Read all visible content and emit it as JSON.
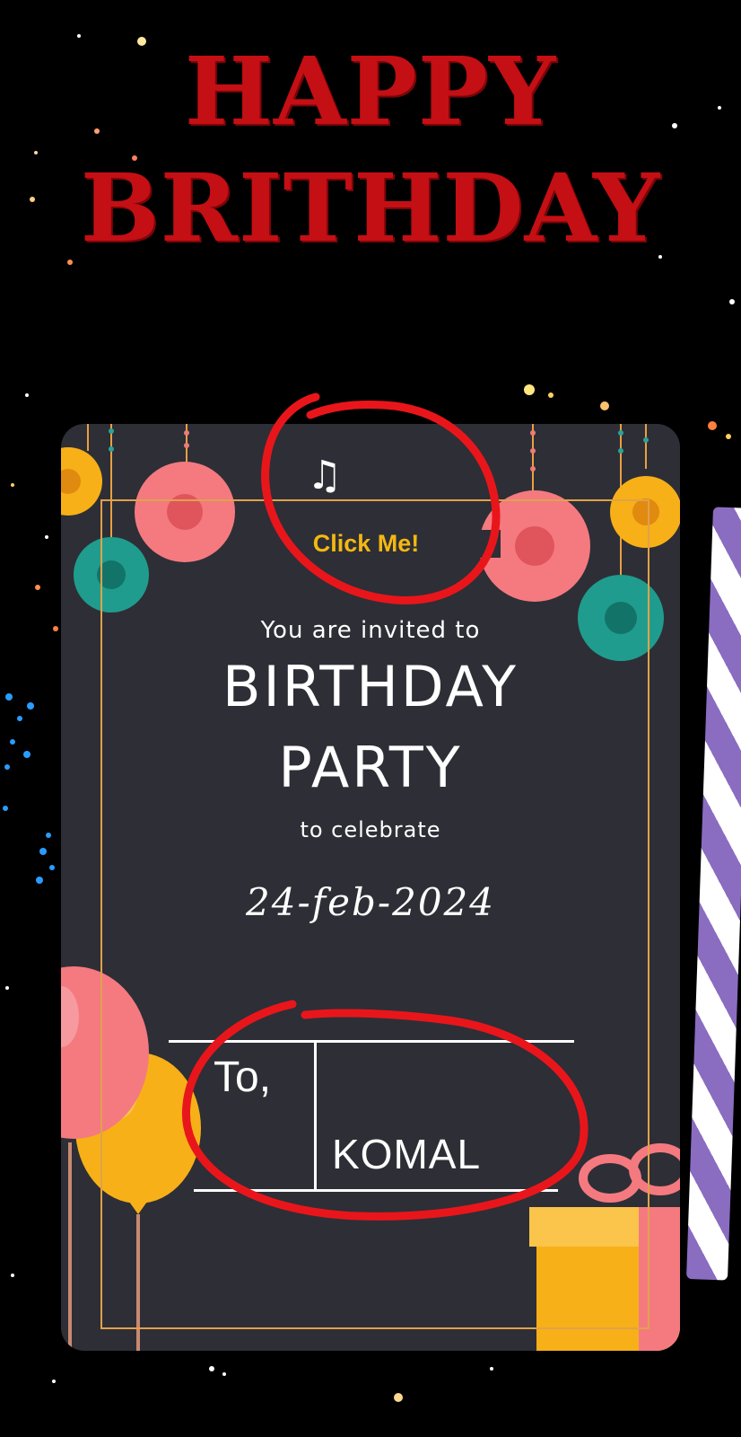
{
  "headline": {
    "line1": "HAPPY",
    "line2": "BRITHDAY"
  },
  "card": {
    "click_label": "Click Me!",
    "music_icon": "♫",
    "invited": "You are invited to",
    "title_line1": "BIRTHDAY",
    "title_line2": "PARTY",
    "subtitle": "to celebrate",
    "date": "24-feb-2024",
    "to_label": "To,",
    "recipient": "KOMAL"
  },
  "colors": {
    "headline": "#c40f14",
    "card_bg": "#2e2e36",
    "click_label": "#f3b812",
    "annotation": "#e8161b",
    "frame": "#e0a24a"
  },
  "icons": [
    "music-note-icon",
    "pompom-decoration",
    "balloon-decoration",
    "gift-box-decoration"
  ]
}
